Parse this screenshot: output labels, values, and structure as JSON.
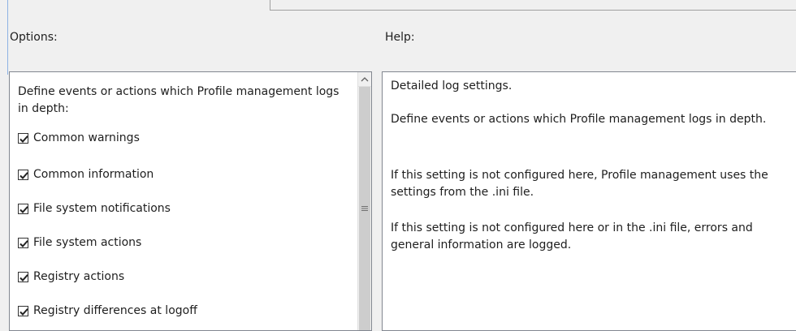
{
  "options_label": "Options:",
  "help_label": "Help:",
  "options": {
    "intro": "Define events or actions which Profile management logs in depth:",
    "items": [
      {
        "label": "Common warnings",
        "checked": true
      },
      {
        "label": "Common information",
        "checked": true
      },
      {
        "label": "File system notifications",
        "checked": true
      },
      {
        "label": "File system actions",
        "checked": true
      },
      {
        "label": "Registry actions",
        "checked": true
      },
      {
        "label": "Registry differences at logoff",
        "checked": true
      }
    ]
  },
  "help": {
    "paragraphs": [
      "Detailed log settings.",
      "Define events or actions which Profile management logs in depth.",
      "If this setting is not configured here, Profile management uses the settings from the .ini file.",
      "If this setting is not configured here or in the .ini file, errors and general information are logged."
    ]
  },
  "icons": {
    "checkbox_check": "checkmark-icon",
    "scroll_up": "chevron-up-icon",
    "scroll_grip": "grip-lines-icon"
  }
}
